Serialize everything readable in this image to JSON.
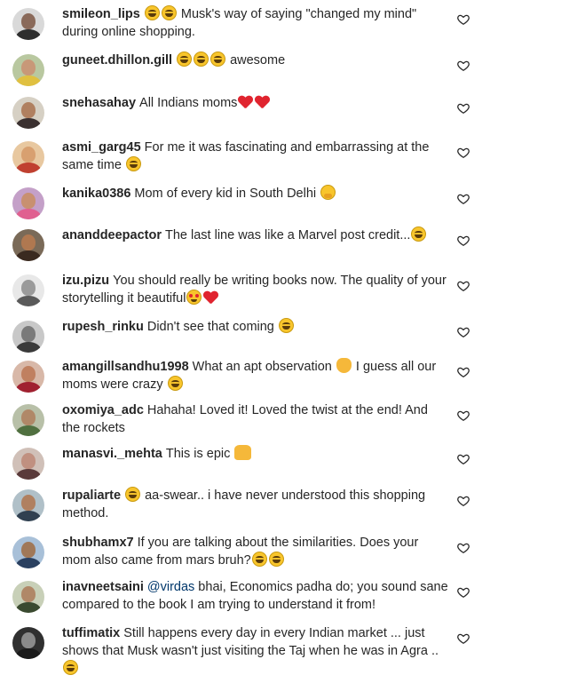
{
  "comments": [
    {
      "username": "smileon_lips",
      "pre": "",
      "mention": "",
      "emoji_before": [
        "laugh",
        "laugh"
      ],
      "text": " Musk's way of saying \"changed my mind\" during online shopping.",
      "emoji_after": [],
      "avatar": {
        "bg": "#d9d9d9",
        "face": "#8a6a5a",
        "body": "#2e2e2e"
      }
    },
    {
      "username": "guneet.dhillon.gill",
      "pre": "",
      "mention": "",
      "emoji_before": [
        "laugh",
        "laugh",
        "laugh"
      ],
      "text": " awesome",
      "emoji_after": [],
      "avatar": {
        "bg": "#b9c8a0",
        "face": "#c89878",
        "body": "#e0c040"
      }
    },
    {
      "username": "snehasahay",
      "pre": "",
      "mention": "",
      "emoji_before": [],
      "text": "All Indians moms",
      "emoji_after": [
        "heart",
        "heart"
      ],
      "avatar": {
        "bg": "#d6d0c4",
        "face": "#b08060",
        "body": "#3a3030"
      }
    },
    {
      "username": "asmi_garg45",
      "pre": "",
      "mention": "",
      "emoji_before": [],
      "text": "For me it was fascinating and embarrassing at the same time ",
      "emoji_after": [
        "laugh"
      ],
      "avatar": {
        "bg": "#e8c8a0",
        "face": "#d8a070",
        "body": "#c04030"
      }
    },
    {
      "username": "kanika0386",
      "pre": "",
      "mention": "",
      "emoji_before": [],
      "text": "Mom of every kid in South Delhi ",
      "emoji_after": [
        "hug"
      ],
      "avatar": {
        "bg": "#c4a0c8",
        "face": "#c89070",
        "body": "#e06090"
      }
    },
    {
      "username": "ananddeepactor",
      "pre": "",
      "mention": "",
      "emoji_before": [],
      "text": "The last line was like a Marvel post credit...",
      "emoji_after": [
        "laugh"
      ],
      "avatar": {
        "bg": "#7a6a58",
        "face": "#b07850",
        "body": "#3a2a20"
      }
    },
    {
      "username": "izu.pizu",
      "pre": "",
      "mention": "",
      "emoji_before": [],
      "text": "You should really be writing books now. The quality of your storytelling it beautiful",
      "emoji_after": [
        "hearteyes",
        "heart"
      ],
      "avatar": {
        "bg": "#e8e8e8",
        "face": "#9a9a9a",
        "body": "#5a5a5a"
      }
    },
    {
      "username": "rupesh_rinku",
      "pre": "",
      "mention": "",
      "emoji_before": [],
      "text": "Didn't see that coming ",
      "emoji_after": [
        "laugh"
      ],
      "avatar": {
        "bg": "#c8c8c8",
        "face": "#7a7a7a",
        "body": "#3a3a3a"
      }
    },
    {
      "username": "amangillsandhu1998",
      "pre": "",
      "mention": "",
      "emoji_before": [],
      "text": "What an apt observation ",
      "emoji_after": [
        "clap"
      ],
      "text2": " I guess all our moms were crazy ",
      "emoji_after2": [
        "laugh"
      ],
      "avatar": {
        "bg": "#d8b8a8",
        "face": "#c08060",
        "body": "#a02030"
      }
    },
    {
      "username": "oxomiya_adc",
      "pre": "",
      "mention": "",
      "emoji_before": [],
      "text": "Hahaha! Loved it! Loved the twist at the end! And the rockets",
      "emoji_after": [],
      "avatar": {
        "bg": "#b8c0a8",
        "face": "#b08868",
        "body": "#507040"
      }
    },
    {
      "username": "manasvi._mehta",
      "pre": "",
      "mention": "",
      "emoji_before": [],
      "text": "This is epic ",
      "emoji_after": [
        "raise"
      ],
      "avatar": {
        "bg": "#d0c0b8",
        "face": "#c09080",
        "body": "#5a3a3a"
      }
    },
    {
      "username": "rupaliarte",
      "pre": "",
      "mention": "",
      "emoji_before": [
        "laugh"
      ],
      "text": " aa-swear.. i have never understood this shopping method.",
      "emoji_after": [],
      "avatar": {
        "bg": "#b0c0c8",
        "face": "#b08060",
        "body": "#304050"
      }
    },
    {
      "username": "shubhamx7",
      "pre": "",
      "mention": "",
      "emoji_before": [],
      "text": "If you are talking about the similarities. Does your mom also came from mars bruh?",
      "emoji_after": [
        "laugh",
        "laugh"
      ],
      "avatar": {
        "bg": "#a8c0d8",
        "face": "#a07858",
        "body": "#2a4060"
      }
    },
    {
      "username": "inavneetsaini",
      "pre": "",
      "mention": "@virdas",
      "emoji_before": [],
      "text": " bhai, Economics padha do; you sound sane compared to the book I am trying to understand it from!",
      "emoji_after": [],
      "avatar": {
        "bg": "#c8d0b8",
        "face": "#b08868",
        "body": "#3a4a30"
      }
    },
    {
      "username": "tuffimatix",
      "pre": "",
      "mention": "",
      "emoji_before": [],
      "text": "Still happens every day in every Indian market ... just shows that Musk wasn't just visiting the Taj when he was in Agra .. ",
      "emoji_after": [
        "laugh"
      ],
      "avatar": {
        "bg": "#303030",
        "face": "#8a8a8a",
        "body": "#1a1a1a"
      }
    }
  ]
}
